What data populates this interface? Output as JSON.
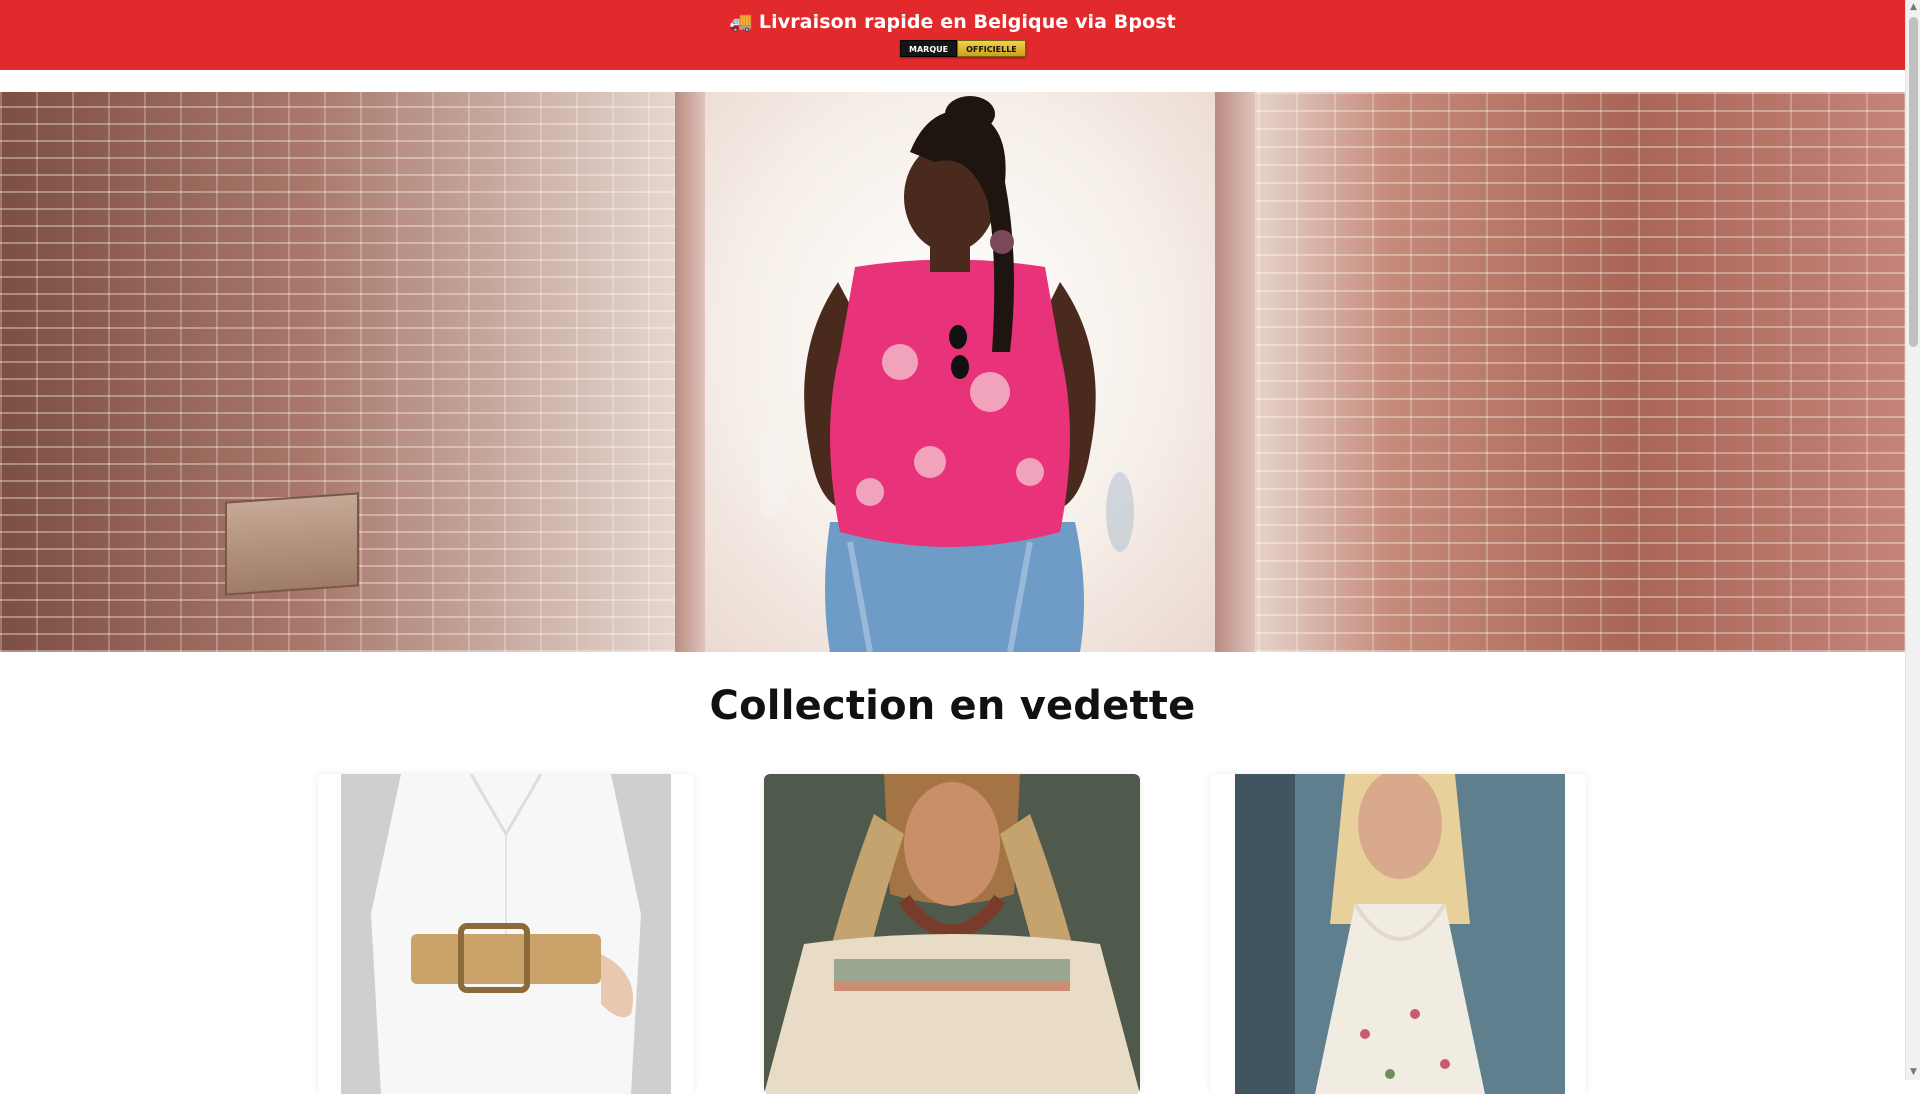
{
  "announcement": {
    "icon": "truck-icon",
    "truck_glyph": "🚚",
    "message": "Livraison rapide en Belgique via Bpost",
    "badge_left": "MARQUE",
    "badge_right": "OFFICIELLE",
    "background_color": "#e22a2c"
  },
  "hero": {
    "image": "woman-in-pink-floral-top-brick-alley"
  },
  "featured": {
    "title": "Collection en vedette",
    "products": [
      {
        "image": "white-shirt-dress-with-straw-belt"
      },
      {
        "image": "boho-off-shoulder-embroidered-blouse"
      },
      {
        "image": "white-floral-sundress"
      }
    ]
  },
  "scrollbar": {
    "up_glyph": "▲",
    "down_glyph": "▼"
  }
}
